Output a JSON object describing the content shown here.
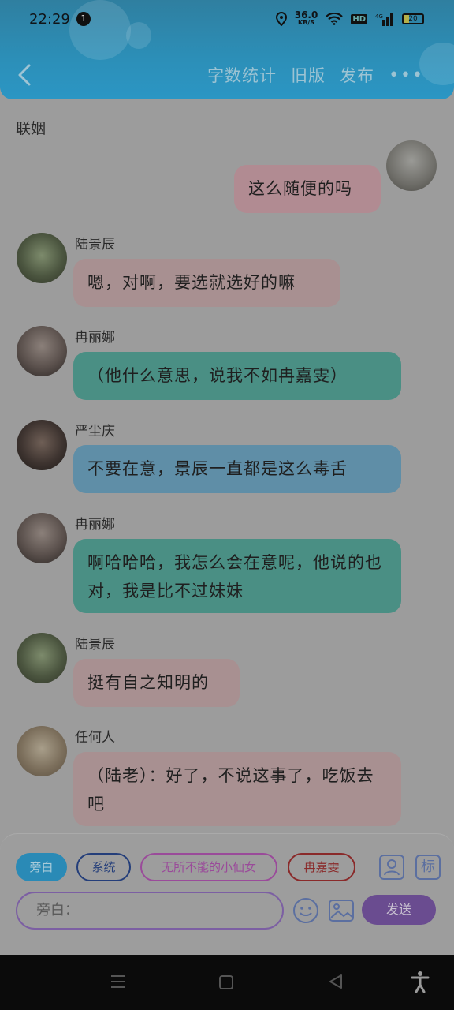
{
  "status_bar": {
    "time": "22:29",
    "notification_count": "1",
    "net_speed_value": "36.0",
    "net_speed_unit": "KB/S",
    "hd": "HD",
    "signal_label": "4G",
    "battery": "20"
  },
  "nav": {
    "word_count": "字数统计",
    "old_version": "旧版",
    "publish": "发布",
    "more_icon": "more-icon"
  },
  "chat": {
    "title": "联姻",
    "messages": [
      {
        "sender": "",
        "text": "这么随便的吗"
      },
      {
        "sender": "陆景辰",
        "text": "嗯，对啊，要选就选好的嘛"
      },
      {
        "sender": "冉丽娜",
        "text": "（他什么意思，说我不如冉嘉雯）"
      },
      {
        "sender": "严尘庆",
        "text": "不要在意，景辰一直都是这么毒舌"
      },
      {
        "sender": "冉丽娜",
        "text": "啊哈哈哈，我怎么会在意呢，他说的也对，我是比不过妹妹"
      },
      {
        "sender": "陆景辰",
        "text": "挺有自之知明的"
      },
      {
        "sender": "任何人",
        "text": "（陆老）：好了，不说这事了，吃饭去吧"
      }
    ]
  },
  "composer": {
    "roles": [
      "旁白",
      "系统",
      "无所不能的小仙女",
      "冉嘉雯"
    ],
    "mark_label": "标",
    "input_placeholder": "旁白：",
    "send_label": "发送"
  },
  "colors": {
    "header": "#2b96c4",
    "accent_purple": "#6a4c90"
  }
}
